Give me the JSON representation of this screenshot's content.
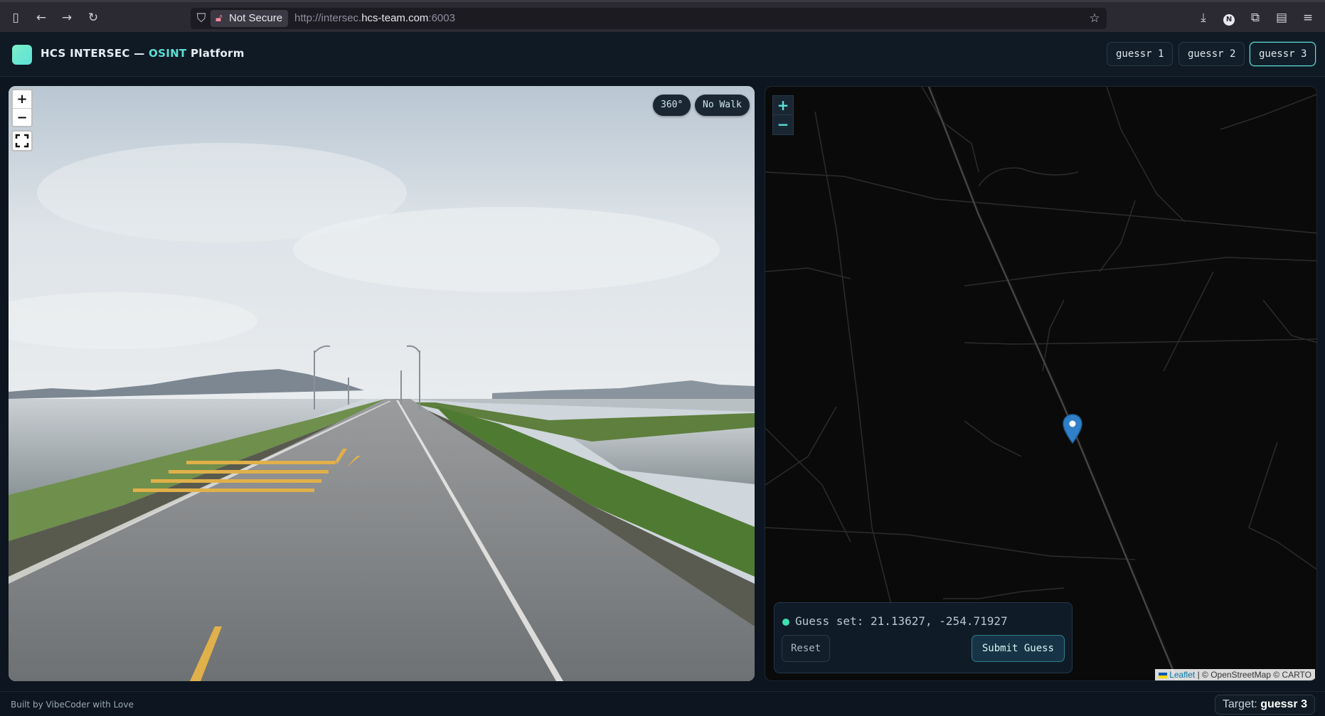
{
  "browser": {
    "security_label": "Not Secure",
    "url_prefix": "http://intersec.",
    "url_host": "hcs-team.com",
    "url_suffix": ":6003"
  },
  "header": {
    "brand_main": "HCS INTERSEC — ",
    "brand_accent": "OSINT",
    "brand_tail": " Platform",
    "tabs": [
      {
        "label": "guessr 1",
        "active": false
      },
      {
        "label": "guessr 2",
        "active": false
      },
      {
        "label": "guessr 3",
        "active": true
      }
    ]
  },
  "street_view": {
    "zoom_in": "+",
    "zoom_out": "−",
    "pill_360": "360°",
    "pill_walk": "No Walk"
  },
  "map": {
    "zoom_in": "+",
    "zoom_out": "−",
    "attribution_leaflet": "Leaflet",
    "attribution_rest": " | © OpenStreetMap © CARTO",
    "guess_text": "Guess set: 21.13627, -254.71927",
    "reset_label": "Reset",
    "submit_label": "Submit Guess"
  },
  "footer": {
    "built_by": "Built by VibeCoder with Love",
    "target_label": "Target: ",
    "target_value": "guessr 3"
  },
  "colors": {
    "accent": "#5ce0d8",
    "background": "#0d1620",
    "map_background": "#0a0a0a",
    "status_dot": "#3fe0b0"
  }
}
